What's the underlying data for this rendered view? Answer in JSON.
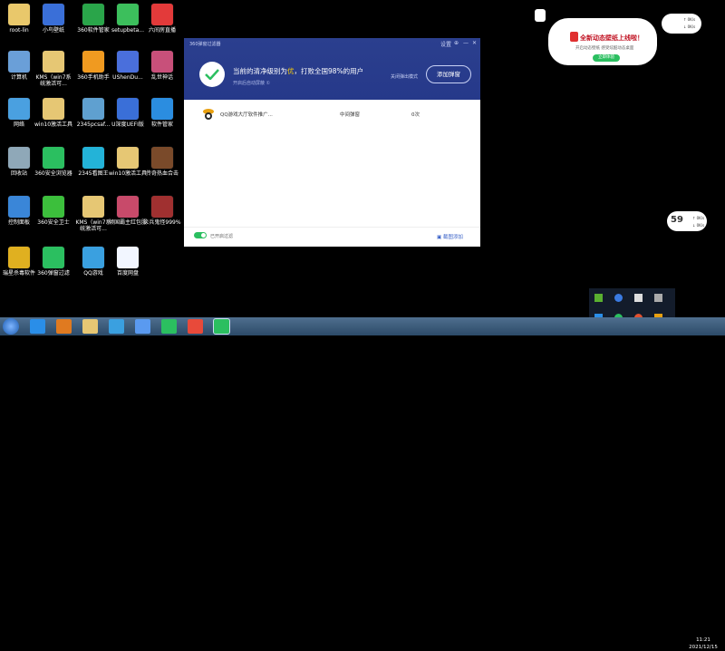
{
  "desktop_icons": [
    {
      "label": "root-lin",
      "color": "#e9c86b"
    },
    {
      "label": "小鸟壁纸",
      "color": "#3a6fd8"
    },
    {
      "label": "360软件管家",
      "color": "#2aa54a"
    },
    {
      "label": "setupbeta...",
      "color": "#3cbf5c"
    },
    {
      "label": "六间房直播",
      "color": "#e33a3a"
    },
    {
      "label": "计算机",
      "color": "#6a9fd8"
    },
    {
      "label": "KMS（win7系统激活可...",
      "color": "#e6c774"
    },
    {
      "label": "360手机助手",
      "color": "#f09a20"
    },
    {
      "label": "UShenDu...",
      "color": "#4a6fdc"
    },
    {
      "label": "乱世神话",
      "color": "#c8507a"
    },
    {
      "label": "网络",
      "color": "#4aa0e0"
    },
    {
      "label": "win10激活工具",
      "color": "#e6c774"
    },
    {
      "label": "2345pcsaf...",
      "color": "#5fa0d0"
    },
    {
      "label": "U深度UEFI版",
      "color": "#3a6fd8"
    },
    {
      "label": "软件管家",
      "color": "#2b8de0"
    },
    {
      "label": "回收站",
      "color": "#8fa8b8"
    },
    {
      "label": "360安全浏览器",
      "color": "#2bbf60"
    },
    {
      "label": "2345看图王",
      "color": "#23b3d8"
    },
    {
      "label": "win10激活工具",
      "color": "#e6c774"
    },
    {
      "label": "传奇热血合击",
      "color": "#7a4a2a"
    },
    {
      "label": "控制面板",
      "color": "#3a86d8"
    },
    {
      "label": "360安全卫士",
      "color": "#3cbf3c"
    },
    {
      "label": "KMS（win7系统激活可...",
      "color": "#e6c774"
    },
    {
      "label": "倾国霸主红包服",
      "color": "#c84a6a"
    },
    {
      "label": "炎兵鬼怪999%",
      "color": "#a03030"
    },
    {
      "label": "瑞星杀毒软件",
      "color": "#e0b020"
    },
    {
      "label": "360弹窗过滤",
      "color": "#2bbf60"
    },
    {
      "label": "QQ游戏",
      "color": "#3aa0e0"
    },
    {
      "label": "百度网盘",
      "color": "#f2f6ff"
    }
  ],
  "window": {
    "title": "360弹窗过滤器",
    "controls": [
      "设置",
      "⊕",
      "—",
      "✕"
    ],
    "headline_pre": "当前的清净级别为",
    "headline_highlight": "优",
    "headline_post": "，打败全国98%的用户",
    "subline": "开启后自动屏蔽 ①",
    "noad_label": "关闭弹出模式",
    "add_button": "添加弹窗",
    "rows": [
      {
        "name": "QQ游戏大厅软件推广...",
        "type": "中间弹窗",
        "count": "0次"
      }
    ],
    "auto_filter_label": "已开启过滤",
    "screenshot_add": "截图添加",
    "accent": "#2b3f8e"
  },
  "bubble": {
    "title": "全新动态壁纸上线啦！",
    "sub": "开启动态壁纸 感受炫酷动态桌面",
    "button": "立即体验"
  },
  "speed_widgets": [
    {
      "pct": "",
      "lines": [
        "↑ 0K/s",
        "↓ 0K/s"
      ]
    },
    {
      "pct": "59",
      "lines": [
        "↑ 0K/s",
        "↓ 0K/s"
      ]
    }
  ],
  "taskbar": {
    "apps": [
      {
        "name": "ie-icon",
        "color": "#2a8ee8"
      },
      {
        "name": "media-player-icon",
        "color": "#e07a20"
      },
      {
        "name": "explorer-icon",
        "color": "#e6c774"
      },
      {
        "name": "qq-game-icon",
        "color": "#3aa0e0"
      },
      {
        "name": "baidu-netdisk-icon",
        "color": "#5a9af0"
      },
      {
        "name": "360-browser-icon",
        "color": "#2bbf60"
      },
      {
        "name": "chrome-icon",
        "color": "#e84a3a"
      },
      {
        "name": "popup-filter-icon",
        "color": "#2bbf60"
      }
    ],
    "time": "11:21",
    "date": "2021/12/15"
  }
}
